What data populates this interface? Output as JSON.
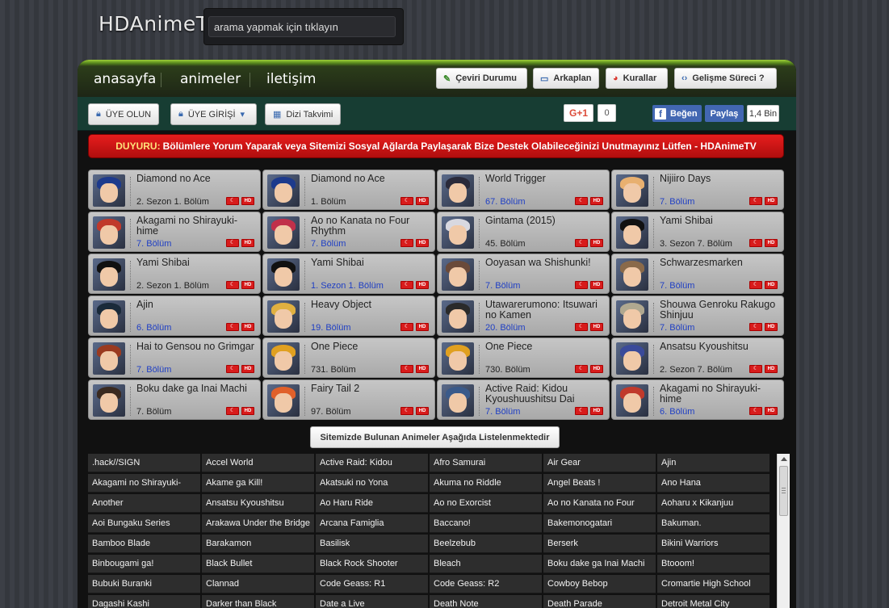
{
  "header": {
    "logo": "HDAnimeTV",
    "search_placeholder": "arama yapmak için tıklayın"
  },
  "nav": {
    "links": [
      "anasayfa",
      "animeler",
      "iletişim"
    ],
    "buttons": [
      {
        "label": "Çeviri Durumu",
        "icon": "pencil-icon"
      },
      {
        "label": "Arkaplan",
        "icon": "window-icon"
      },
      {
        "label": "Kurallar",
        "icon": "pie-chart-icon"
      },
      {
        "label": "Gelişme Süreci ?",
        "icon": "code-icon"
      }
    ]
  },
  "subbar": {
    "register": "ÜYE OLUN",
    "login": "ÜYE GİRİŞİ",
    "calendar": "Dizi Takvimi",
    "gplus": "G+1",
    "gplus_count": "0",
    "fb_like": "Beğen",
    "fb_share": "Paylaş",
    "fb_count": "1,4 Bin"
  },
  "announcement": {
    "label": "DUYURU:",
    "text": "Bölümlere Yorum Yaparak veya Sitemizi Sosyal Ağlarda Paylaşarak Bize Destek Olabileceğinizi Unutmayınız Lütfen - HDAnimeTV"
  },
  "episodes": [
    {
      "title": "Diamond no Ace",
      "episode": "2. Sezon 1. Bölüm",
      "highlight": false,
      "hair": "#1d3a8c"
    },
    {
      "title": "Diamond no Ace",
      "episode": "1. Bölüm",
      "highlight": false,
      "hair": "#1d3a8c"
    },
    {
      "title": "World Trigger",
      "episode": "67. Bölüm",
      "highlight": true,
      "hair": "#2a2a3a"
    },
    {
      "title": "Nijiiro Days",
      "episode": "7. Bölüm",
      "highlight": true,
      "hair": "#e8b070"
    },
    {
      "title": "Akagami no Shirayuki-hime",
      "episode": "7. Bölüm",
      "highlight": true,
      "hair": "#c0392b"
    },
    {
      "title": "Ao no Kanata no Four Rhythm",
      "episode": "7. Bölüm",
      "highlight": true,
      "hair": "#c0304a"
    },
    {
      "title": "Gintama (2015)",
      "episode": "45. Bölüm",
      "highlight": false,
      "hair": "#d8d8e0"
    },
    {
      "title": "Yami Shibai",
      "episode": "3. Sezon 7. Bölüm",
      "highlight": false,
      "hair": "#111111"
    },
    {
      "title": "Yami Shibai",
      "episode": "2. Sezon 1. Bölüm",
      "highlight": false,
      "hair": "#111111"
    },
    {
      "title": "Yami Shibai",
      "episode": "1. Sezon 1. Bölüm",
      "highlight": true,
      "hair": "#111111"
    },
    {
      "title": "Ooyasan wa Shishunki!",
      "episode": "7. Bölüm",
      "highlight": true,
      "hair": "#6a4a3a"
    },
    {
      "title": "Schwarzesmarken",
      "episode": "7. Bölüm",
      "highlight": true,
      "hair": "#8a6a4a"
    },
    {
      "title": "Ajin",
      "episode": "6. Bölüm",
      "highlight": true,
      "hair": "#1a2a3a"
    },
    {
      "title": "Heavy Object",
      "episode": "19. Bölüm",
      "highlight": true,
      "hair": "#e0b040"
    },
    {
      "title": "Utawarerumono: Itsuwari no Kamen",
      "episode": "20. Bölüm",
      "highlight": true,
      "hair": "#2a2a2a"
    },
    {
      "title": "Shouwa Genroku Rakugo Shinjuu",
      "episode": "7. Bölüm",
      "highlight": true,
      "hair": "#b0a890"
    },
    {
      "title": "Hai to Gensou no Grimgar",
      "episode": "7. Bölüm",
      "highlight": true,
      "hair": "#9a3a20"
    },
    {
      "title": "One Piece",
      "episode": "731. Bölüm",
      "highlight": false,
      "hair": "#e0a020"
    },
    {
      "title": "One Piece",
      "episode": "730. Bölüm",
      "highlight": false,
      "hair": "#e0a020"
    },
    {
      "title": "Ansatsu Kyoushitsu",
      "episode": "2. Sezon 7. Bölüm",
      "highlight": false,
      "hair": "#3a4a9a"
    },
    {
      "title": "Boku dake ga Inai Machi",
      "episode": "7. Bölüm",
      "highlight": false,
      "hair": "#3a2a20"
    },
    {
      "title": "Fairy Tail 2",
      "episode": "97. Bölüm",
      "highlight": false,
      "hair": "#e0602a"
    },
    {
      "title": "Active Raid: Kidou Kyoushuushitsu Dai",
      "episode": "7. Bölüm",
      "highlight": true,
      "hair": "#3a5a8a"
    },
    {
      "title": "Akagami no Shirayuki-hime",
      "episode": "6. Bölüm",
      "highlight": true,
      "hair": "#c0392b"
    }
  ],
  "list_button": "Sitemizde Bulunan Animeler Aşağıda Listelenmektedir",
  "anime_list": [
    ".hack//SIGN",
    "Accel World",
    "Active Raid: Kidou",
    "Afro Samurai",
    "Air Gear",
    "Ajin",
    "Akagami no Shirayuki-",
    "Akame ga Kill!",
    "Akatsuki no Yona",
    "Akuma no Riddle",
    "Angel Beats !",
    "Ano Hana",
    "Another",
    "Ansatsu Kyoushitsu",
    "Ao Haru Ride",
    "Ao no Exorcist",
    "Ao no Kanata no Four",
    "Aoharu x Kikanjuu",
    "Aoi Bungaku Series",
    "Arakawa Under the Bridge",
    "Arcana Famiglia",
    "Baccano!",
    "Bakemonogatari",
    "Bakuman.",
    "Bamboo Blade",
    "Barakamon",
    "Basilisk",
    "Beelzebub",
    "Berserk",
    "Bikini Warriors",
    "Binbougami ga!",
    "Black Bullet",
    "Black Rock Shooter",
    "Bleach",
    "Boku dake ga Inai Machi",
    "Btooom!",
    "Bubuki Buranki",
    "Clannad",
    "Code Geass: R1",
    "Code Geass: R2",
    "Cowboy Bebop",
    "Cromartie High School",
    "Dagashi Kashi",
    "Darker than Black",
    "Date a Live",
    "Death Note",
    "Death Parade",
    "Detroit Metal City"
  ]
}
